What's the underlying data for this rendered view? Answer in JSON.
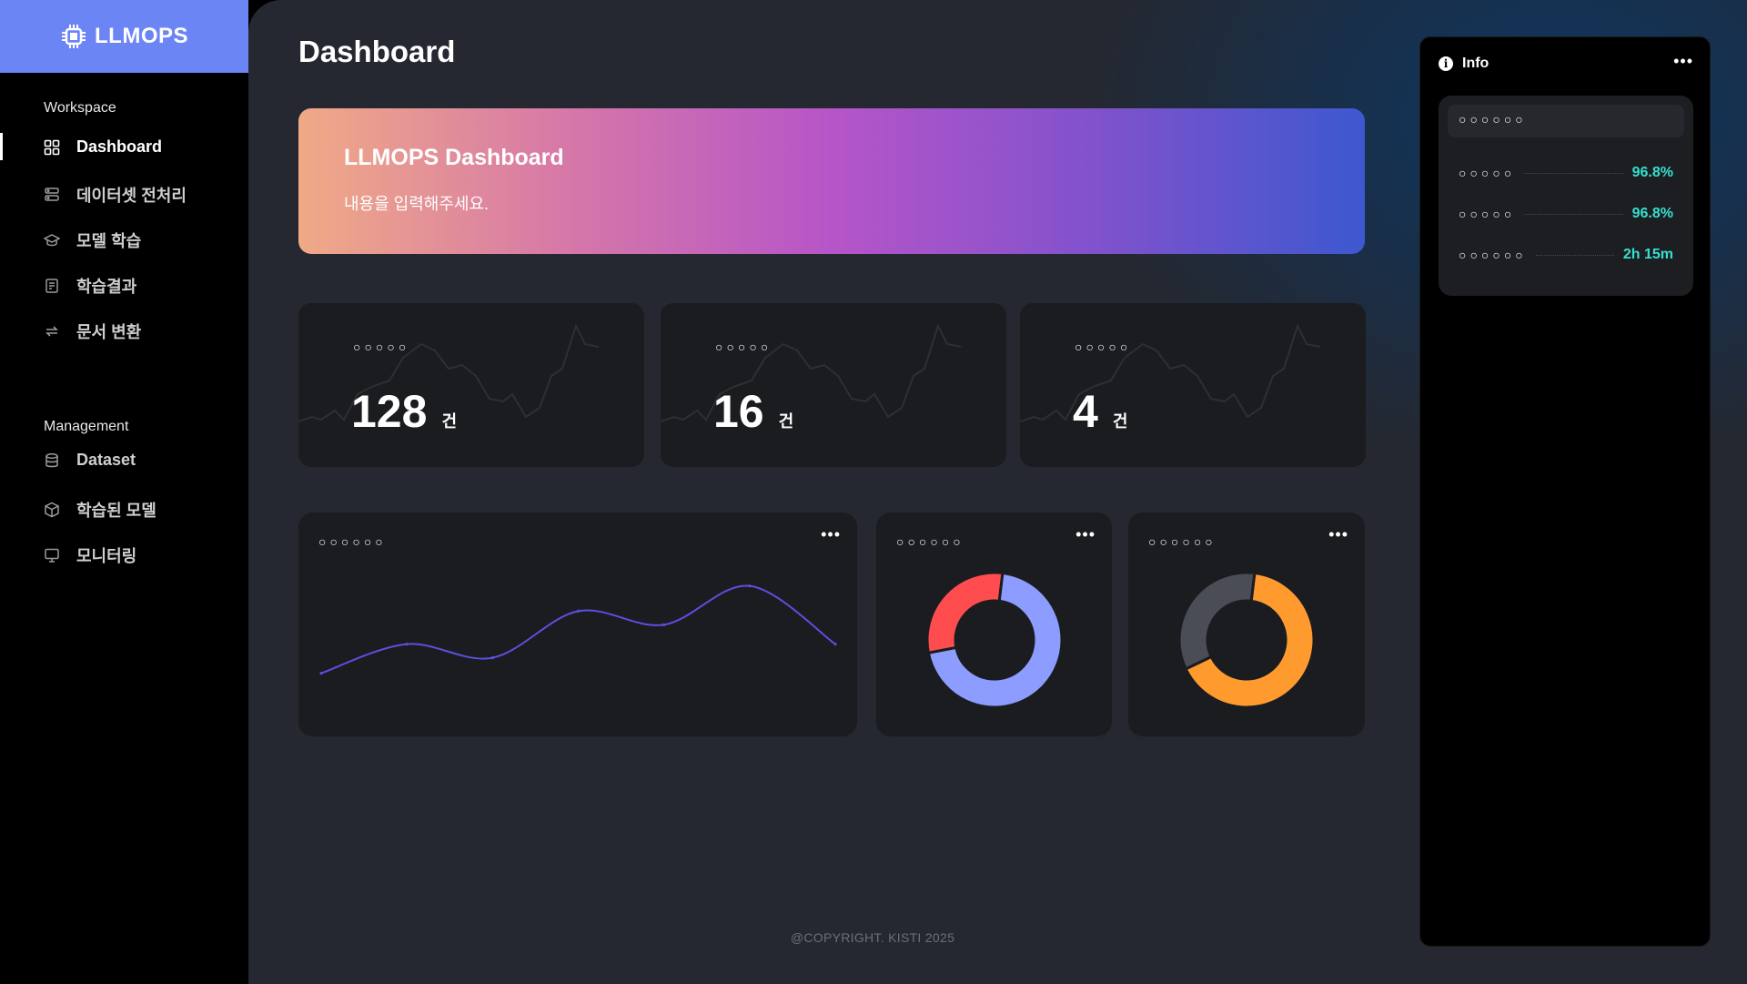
{
  "brand": {
    "name": "LLMOPS"
  },
  "sidebar": {
    "workspace_label": "Workspace",
    "workspace_items": [
      {
        "label": "Dashboard",
        "icon": "grid-icon",
        "active": true
      },
      {
        "label": "데이터셋 전처리",
        "icon": "server-icon"
      },
      {
        "label": "모델 학습",
        "icon": "graduation-cap-icon"
      },
      {
        "label": "학습결과",
        "icon": "report-icon"
      },
      {
        "label": "문서 변환",
        "icon": "convert-icon"
      }
    ],
    "management_label": "Management",
    "management_items": [
      {
        "label": "Dataset",
        "icon": "database-icon"
      },
      {
        "label": "학습된 모델",
        "icon": "cube-icon"
      },
      {
        "label": "모니터링",
        "icon": "monitor-icon"
      }
    ]
  },
  "main": {
    "title": "Dashboard",
    "banner": {
      "title": "LLMOPS Dashboard",
      "subtitle": "내용을 입력해주세요."
    },
    "stats": [
      {
        "label": "○○○○○",
        "value": "128",
        "unit": "건"
      },
      {
        "label": "○○○○○",
        "value": "16",
        "unit": "건"
      },
      {
        "label": "○○○○○",
        "value": "4",
        "unit": "건"
      }
    ],
    "panels": {
      "line": {
        "label": "○○○○○○",
        "more": "•••"
      },
      "donut1": {
        "label": "○○○○○○",
        "more": "•••"
      },
      "donut2": {
        "label": "○○○○○○",
        "more": "•••"
      }
    },
    "footer": "@COPYRIGHT. KISTI 2025"
  },
  "info": {
    "title": "Info",
    "more": "•••",
    "card_header": "○○○○○○",
    "rows": [
      {
        "label": "○○○○○",
        "value": "96.8%"
      },
      {
        "label": "○○○○○",
        "value": "96.8%"
      },
      {
        "label": "○○○○○○",
        "value": "2h 15m"
      }
    ]
  },
  "colors": {
    "brand": "#6c85f5",
    "accent_teal": "#35e0d0",
    "line": "#5b4fe0",
    "donut1_a": "#8c9cff",
    "donut1_b": "#ff4d4f",
    "donut2_a": "#ff9b2e",
    "donut2_b": "#4a4d55"
  },
  "chart_data": [
    {
      "type": "line",
      "x": [
        0,
        1,
        2,
        3,
        4,
        5,
        6
      ],
      "values": [
        10,
        25,
        18,
        42,
        35,
        55,
        25
      ],
      "ylim": [
        0,
        60
      ]
    },
    {
      "type": "pie",
      "values": [
        70,
        30
      ],
      "colors": [
        "#8c9cff",
        "#ff4d4f"
      ]
    },
    {
      "type": "pie",
      "values": [
        66,
        34
      ],
      "colors": [
        "#ff9b2e",
        "#4a4d55"
      ]
    }
  ]
}
